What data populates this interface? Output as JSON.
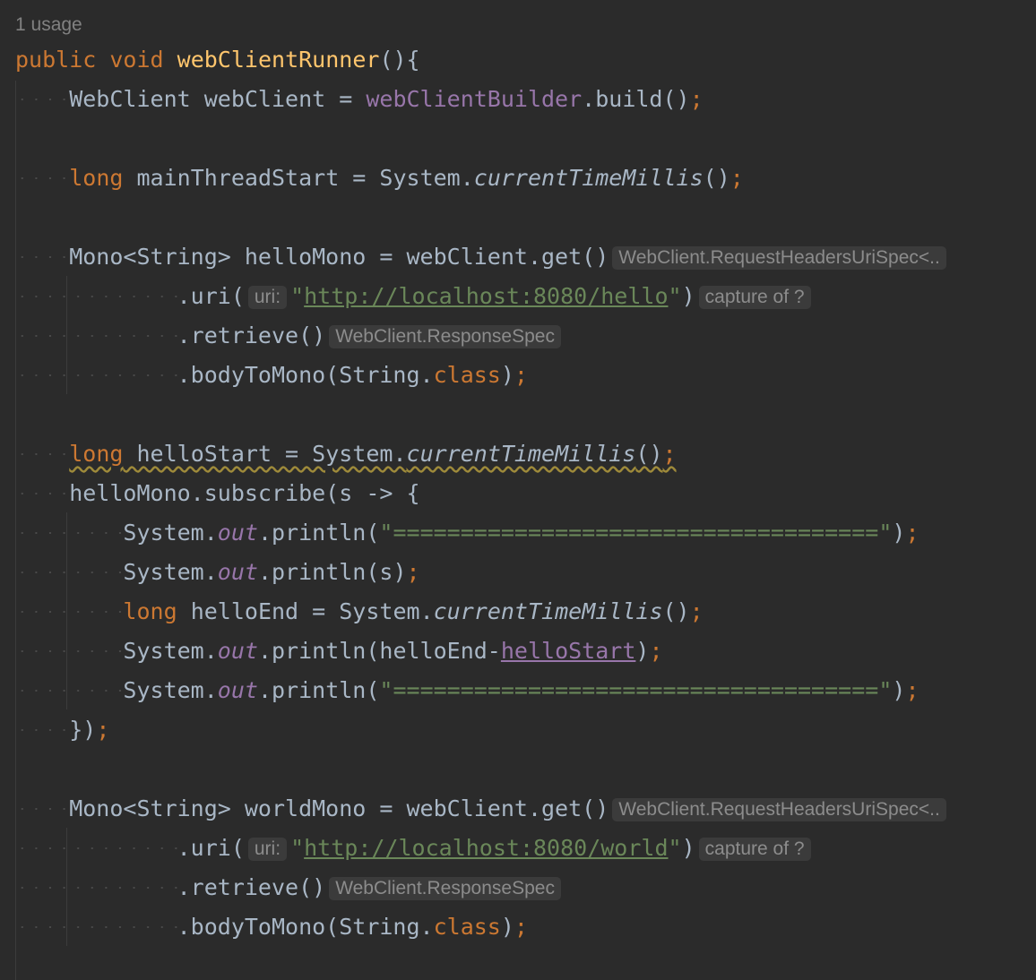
{
  "usage_label": "1 usage",
  "hints": {
    "request_headers_spec": "WebClient.RequestHeadersUriSpec<..",
    "uri_param": "uri:",
    "capture_of": "capture of ?",
    "response_spec": "WebClient.ResponseSpec"
  },
  "code": {
    "method_signature_kw1": "public",
    "method_signature_kw2": "void",
    "method_name": "webClientRunner",
    "hello_url": "http://localhost:8080/hello",
    "world_url": "http://localhost:8080/world",
    "separator_string": "===================================="
  },
  "colors": {
    "background": "#2b2b2b",
    "keyword": "#cc7832",
    "method": "#ffc66d",
    "field": "#9876aa",
    "string": "#6a8759",
    "text": "#a9b7c6"
  }
}
